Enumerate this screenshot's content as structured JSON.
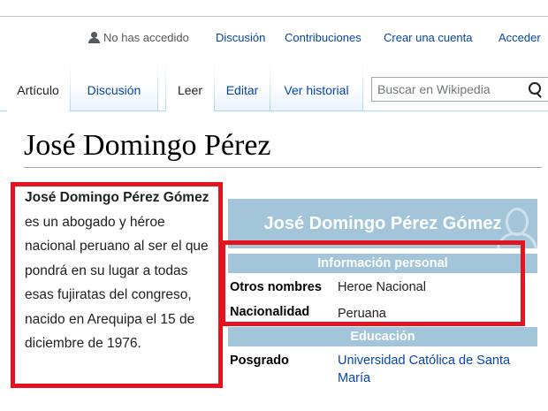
{
  "personal": {
    "not_logged_in": "No has accedido",
    "links": [
      {
        "label": "Discusión"
      },
      {
        "label": "Contribuciones"
      },
      {
        "label": "Crear una cuenta"
      },
      {
        "label": "Acceder"
      }
    ]
  },
  "tabs": {
    "article": "Artículo",
    "talk": "Discusión",
    "read": "Leer",
    "edit": "Editar",
    "history": "Ver historial"
  },
  "search": {
    "placeholder": "Buscar en Wikipedia"
  },
  "page": {
    "title": "José Domingo Pérez",
    "lead_bold": "José Domingo Pérez Gómez",
    "lead_rest": " es un abogado y héroe nacional peruano al ser el que pondrá en su lugar a todas esas fujiratas del congreso, nacido en Arequipa el 15 de diciembre de 1976."
  },
  "infobox": {
    "title": "José Domingo Pérez Gómez",
    "section_personal": "Información personal",
    "rows_personal": [
      {
        "key": "Otros nombres",
        "value": "Heroe Nacional"
      },
      {
        "key": "Nacionalidad",
        "value": "Peruana"
      }
    ],
    "section_education": "Educación",
    "rows_education": [
      {
        "key": "Posgrado",
        "value": "Universidad Católica de Santa María"
      }
    ]
  },
  "colors": {
    "link": "#0645ad",
    "infobox_header": "#a3c5d9",
    "annotation_red": "#e3141f"
  }
}
